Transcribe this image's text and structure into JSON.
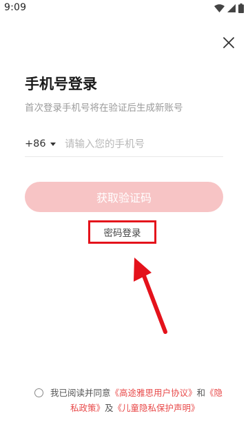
{
  "status_bar": {
    "time": "9:09",
    "icons": [
      "wifi-icon",
      "signal-icon",
      "battery-icon"
    ]
  },
  "header": {
    "close_icon": "close-icon"
  },
  "login": {
    "title": "手机号登录",
    "subtitle": "首次登录手机号将在验证后生成新账号",
    "country_code": "+86",
    "phone_placeholder": "请输入您的手机号",
    "phone_value": "",
    "get_code_label": "获取验证码",
    "password_login_label": "密码登录"
  },
  "agreement": {
    "prefix": "我已阅读并同意",
    "user_agreement": "《高途雅思用户协议》",
    "and": "和",
    "privacy_policy_part1": "《隐",
    "privacy_policy_part2": "私政策》",
    "and2": "及",
    "child_privacy": "《儿童隐私保护声明》",
    "checked": false
  },
  "colors": {
    "primary_disabled": "#f7c4c5",
    "link": "#e84a4a",
    "highlight": "#e4121b"
  }
}
